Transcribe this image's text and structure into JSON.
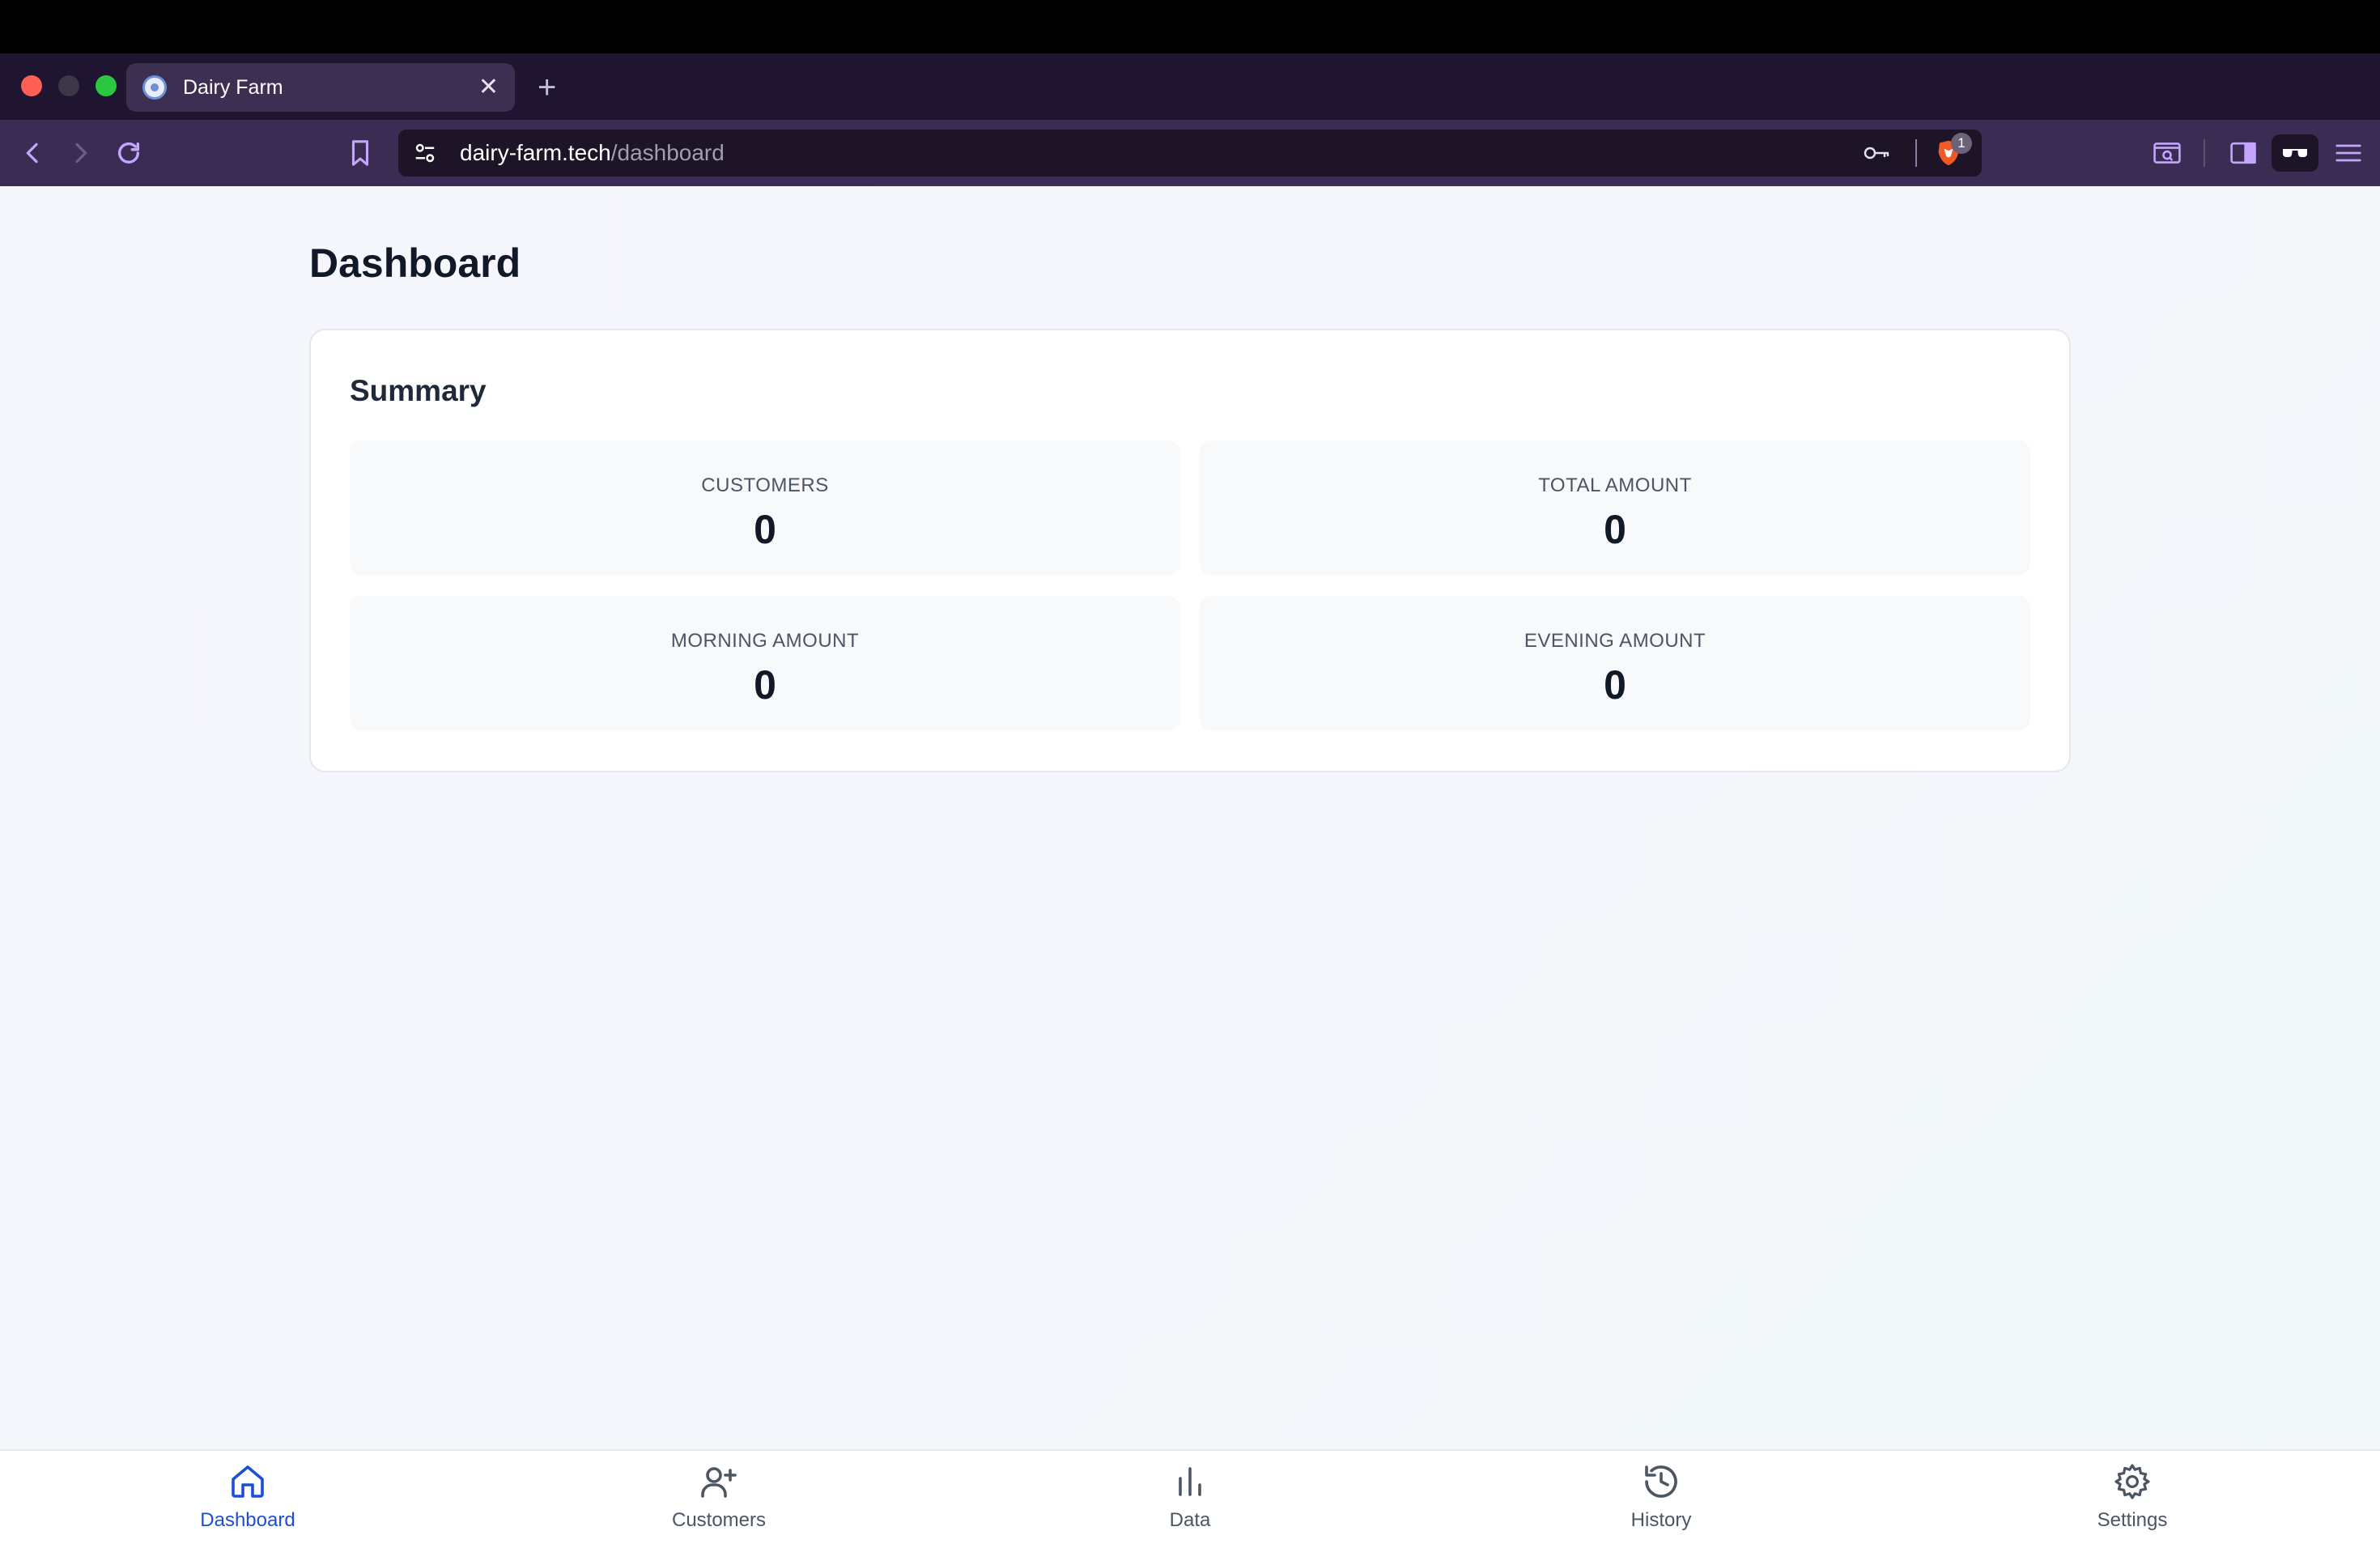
{
  "browser": {
    "tab_title": "Dairy Farm",
    "new_tab_symbol": "+",
    "close_symbol": "✕",
    "url_host": "dairy-farm.tech",
    "url_path": "/dashboard",
    "shield_badge": "1"
  },
  "page": {
    "title": "Dashboard",
    "summary": {
      "title": "Summary",
      "stats": [
        {
          "label": "CUSTOMERS",
          "value": "0"
        },
        {
          "label": "TOTAL AMOUNT",
          "value": "0"
        },
        {
          "label": "MORNING AMOUNT",
          "value": "0"
        },
        {
          "label": "EVENING AMOUNT",
          "value": "0"
        }
      ]
    }
  },
  "nav": {
    "active": "Dashboard",
    "items": [
      {
        "label": "Dashboard",
        "icon": "home-icon"
      },
      {
        "label": "Customers",
        "icon": "user-plus-icon"
      },
      {
        "label": "Data",
        "icon": "bar-chart-icon"
      },
      {
        "label": "History",
        "icon": "history-icon"
      },
      {
        "label": "Settings",
        "icon": "gear-icon"
      }
    ]
  },
  "colors": {
    "accent": "#1d4ed8",
    "toolbar": "#3a2c52",
    "tabbar": "#1f1530"
  }
}
